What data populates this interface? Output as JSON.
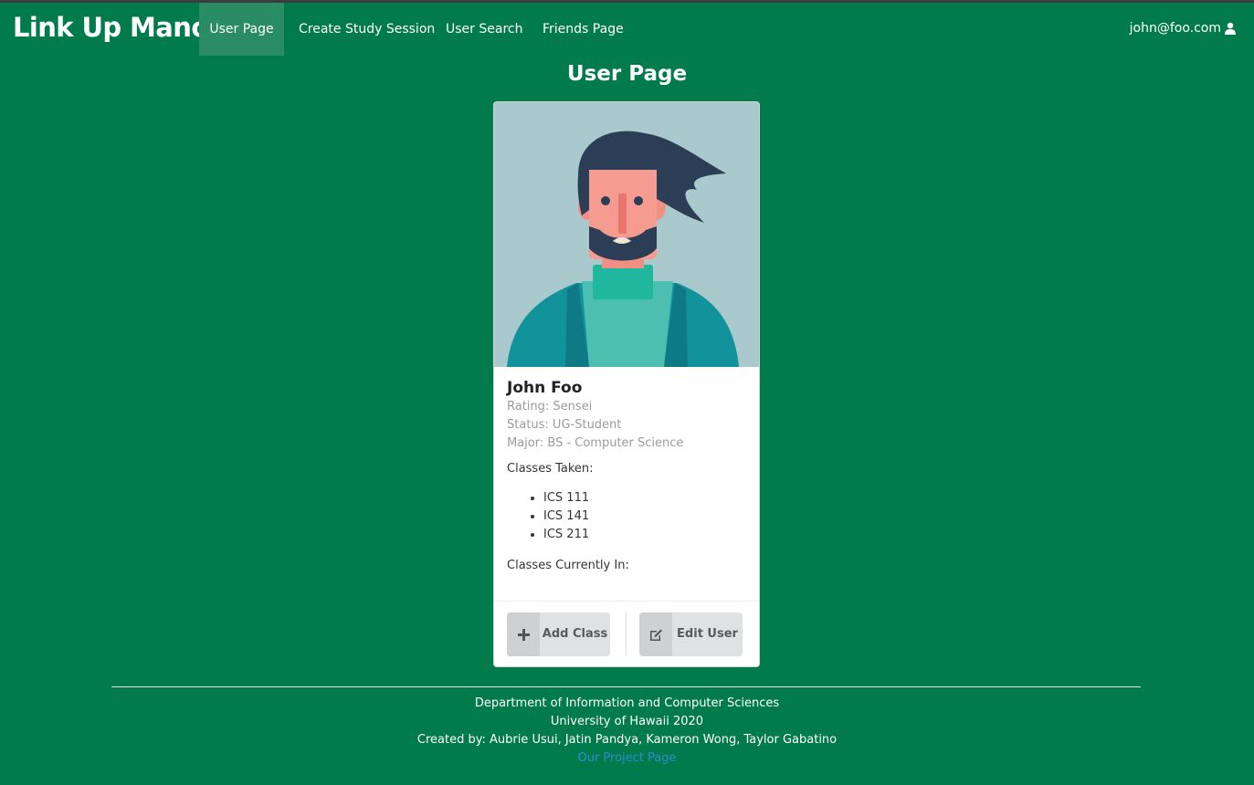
{
  "navbar": {
    "brand": "Link Up Manoa",
    "items": [
      {
        "label": "User Page",
        "active": true
      },
      {
        "label": "Create Study Session",
        "active": false
      },
      {
        "label": "User Search",
        "active": false
      },
      {
        "label": "Friends Page",
        "active": false
      }
    ],
    "user_email": "john@foo.com",
    "user_icon": "user-icon"
  },
  "page": {
    "title": "User Page"
  },
  "card": {
    "name": "John Foo",
    "rating": "Rating: Sensei",
    "status": "Status: UG-Student",
    "major": "Major: BS - Computer Science",
    "classes_taken_label": "Classes Taken:",
    "classes_taken": [
      "ICS 111",
      "ICS 141",
      "ICS 211"
    ],
    "classes_current_label": "Classes Currently In:",
    "buttons": {
      "add_class": "Add Class",
      "add_class_icon": "plus-icon",
      "edit_user": "Edit User",
      "edit_user_icon": "edit-icon"
    }
  },
  "footer": {
    "line1": "Department of Information and Computer Sciences",
    "line2": "University of Hawaii 2020",
    "line3": "Created by: Aubrie Usui, Jatin Pandya, Kameron Wong, Taylor Gabatino",
    "link": "Our Project Page"
  },
  "colors": {
    "background": "#017b4b",
    "active_nav": "#2a8c63",
    "link": "#2f8ccf"
  }
}
